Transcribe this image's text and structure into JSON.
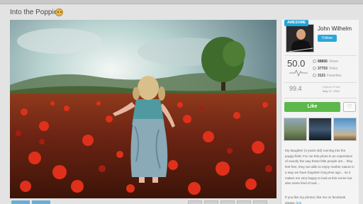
{
  "page": {
    "title": "Into the Poppies"
  },
  "sidebar": {
    "badge": "AWESOME",
    "username": "John Wilhelm",
    "follow_label": "Follow",
    "score": "50.0",
    "stats": [
      {
        "value": "88866",
        "label": "Views"
      },
      {
        "value": "37753",
        "label": "Votes"
      },
      {
        "value": "3121",
        "label": "Favorites"
      }
    ],
    "highest_score": "99.4",
    "peak_label": "Highest Pulse",
    "peak_date": "May 27, 2012",
    "like_label": "Like",
    "description": "My daughter (4 years old) running into the poppy-field. For me this photo is an expression of exactly the way those little people are... they feel free, they are able to enjoy mother nature in a way we have forgotten long time ago... so it makes me very happy to look at this scene but also some kind of sad....",
    "description2_prefix": "If you like my photos, like me on facebook please: ",
    "description2_link": "link"
  },
  "colors": {
    "like_green": "#5cb84a",
    "follow_blue": "#2aa7db",
    "badge_blue": "#1ea4d8"
  }
}
